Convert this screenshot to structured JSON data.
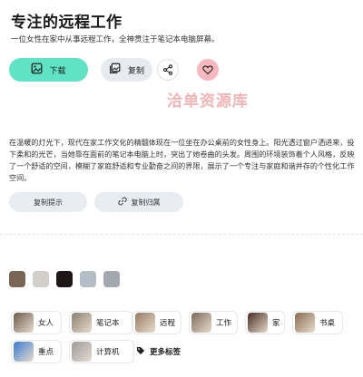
{
  "header": {
    "title": "专注的远程工作",
    "subtitle": "一位女性在家中从事远程工作，全神贯注于笔记本电脑屏幕。"
  },
  "actions": {
    "download_label": "下载",
    "copy_label": "复制",
    "share_icon": "share-icon",
    "like_icon": "heart-icon"
  },
  "watermark": "洽单资源库",
  "description": "在温暖的灯光下，现代在家工作文化的精髓体现在一位坐在办公桌前的女性身上。阳光透过窗户洒进来，投下柔和的光芒，当她靠在面前的笔记本电脑上时，突出了她卷曲的头发。周围的环境装饰着个人风格，反映了一个舒适的空间，模糊了家庭舒适和专业勤奋之间的界限，展示了一个专注与家庭和谐并存的个性化工作空间。",
  "pills": {
    "copy_prompt": "复制提示",
    "copy_attribution": "复制归属"
  },
  "colors": {
    "accent": "#5fe3c4",
    "like": "#f8b8c0",
    "palette": [
      "#7a6455",
      "#d2cfca",
      "#1e1616",
      "#b4bcc6",
      "#a3a8b0"
    ]
  },
  "tags": [
    {
      "label": "女人",
      "thumb_color": "#6b5a4a"
    },
    {
      "label": "笔记本",
      "thumb_color": "#8a8070"
    },
    {
      "label": "远程",
      "thumb_color": "#9a7b62"
    },
    {
      "label": "工作",
      "thumb_color": "#7c6a5a"
    },
    {
      "label": "家",
      "thumb_color": "#4a2a20"
    },
    {
      "label": "书桌",
      "thumb_color": "#8b6b50"
    },
    {
      "label": "重点",
      "thumb_color": "#3a7ad0"
    },
    {
      "label": "计算机",
      "thumb_color": "#9b9b9b"
    },
    {
      "label": "更多标签",
      "icon": "tag-icon"
    }
  ]
}
